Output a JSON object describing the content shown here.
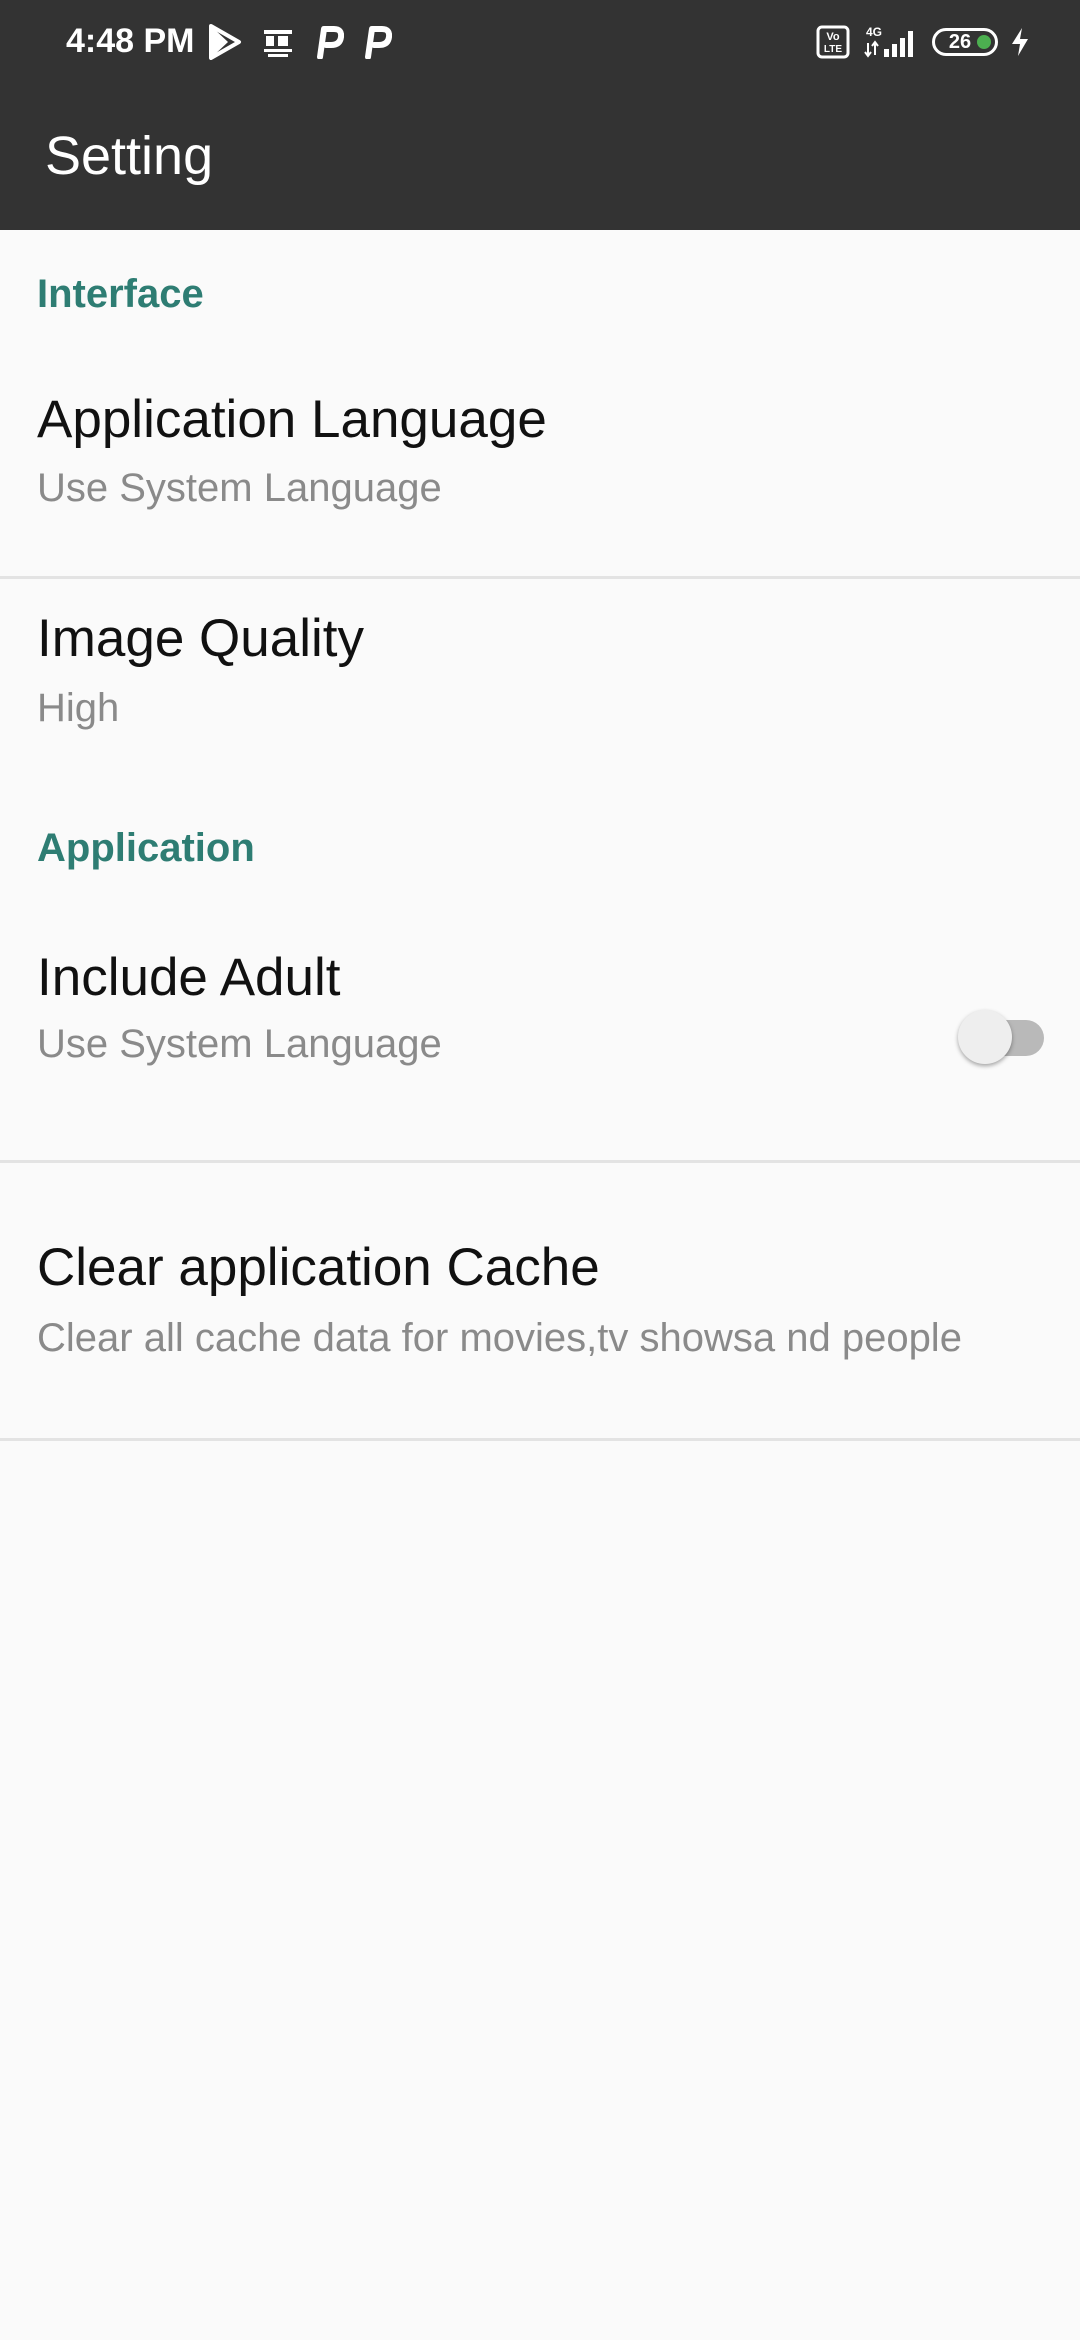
{
  "status_bar": {
    "time": "4:48 PM",
    "notification_icons": [
      "play-store-icon",
      "dainik-bhaskar-icon",
      "p-app-icon",
      "p-app-icon"
    ],
    "system_icons": [
      "volte-icon",
      "4g-signal-icon",
      "battery-icon",
      "charging-icon"
    ],
    "network_label": "4G",
    "volte_label": "Vo LTE",
    "battery_level": "26",
    "battery_color": "#4caf50"
  },
  "app_bar": {
    "title": "Setting",
    "background": "#333333"
  },
  "sections": {
    "interface": {
      "header": "Interface",
      "color": "#2e7d73"
    },
    "application": {
      "header": "Application",
      "color": "#2e7d73"
    }
  },
  "preferences": {
    "app_language": {
      "title": "Application Language",
      "summary": "Use System Language"
    },
    "image_quality": {
      "title": "Image Quality",
      "summary": "High"
    },
    "include_adult": {
      "title": "Include Adult",
      "summary": "Use System Language",
      "enabled": false
    },
    "clear_cache": {
      "title": "Clear application Cache",
      "summary": "Clear all cache data for movies,tv showsa nd people"
    }
  }
}
